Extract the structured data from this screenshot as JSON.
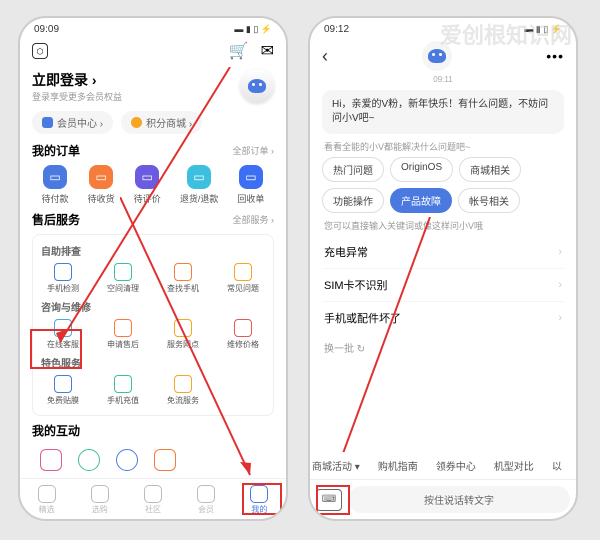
{
  "watermark": "爱创根知识网",
  "p1": {
    "time": "09:09",
    "status_icons": "◉ ⬨ ▪ ▪",
    "login_title": "立即登录 ›",
    "login_sub": "登录享受更多会员权益",
    "chip1": "会员中心 ›",
    "chip2": "积分商城 ›",
    "orders_title": "我的订单",
    "orders_more": "全部订单 ›",
    "orders": [
      {
        "label": "待付款",
        "color": "#4a7ae0"
      },
      {
        "label": "待收货",
        "color": "#f57c3a"
      },
      {
        "label": "待评价",
        "color": "#6b5be0"
      },
      {
        "label": "退货/退款",
        "color": "#3dc0e0"
      },
      {
        "label": "回收单",
        "color": "#3d6ff5"
      }
    ],
    "after_title": "售后服务",
    "after_more": "全部服务 ›",
    "g1_label": "自助排查",
    "g1": [
      {
        "label": "手机检测",
        "color": "#4a7ae0"
      },
      {
        "label": "空间清理",
        "color": "#3dbf9f"
      },
      {
        "label": "查找手机",
        "color": "#f57c3a"
      },
      {
        "label": "常见问题",
        "color": "#f5a623"
      }
    ],
    "g2_label": "咨询与维修",
    "g2": [
      {
        "label": "在线客服",
        "color": "#4aa7e0"
      },
      {
        "label": "申请售后",
        "color": "#f57c3a"
      },
      {
        "label": "服务网点",
        "color": "#f5a623"
      },
      {
        "label": "维修价格",
        "color": "#e05a5a"
      }
    ],
    "g3_label": "特色服务",
    "g3": [
      {
        "label": "免费贴膜",
        "color": "#4a7ae0"
      },
      {
        "label": "手机充值",
        "color": "#3dbf9f"
      },
      {
        "label": "免流服务",
        "color": "#f5a623"
      }
    ],
    "interact_title": "我的互动",
    "tabs": [
      {
        "label": "精选"
      },
      {
        "label": "选购"
      },
      {
        "label": "社区"
      },
      {
        "label": "会员"
      },
      {
        "label": "我的"
      }
    ]
  },
  "p2": {
    "time": "09:12",
    "status_icons": "◉ ▪ ▪ ▪",
    "msg_time": "09:11",
    "greeting": "Hi，亲爱的V粉，新年快乐！有什么问题，不妨问问小V吧~",
    "tags_label": "看看全能的小V都能解决什么问题吧~",
    "tags": [
      "热门问题",
      "OriginOS",
      "商城相关",
      "功能操作",
      "产品故障",
      "帐号相关"
    ],
    "active_tag_index": 4,
    "list_label": "您可以直接输入关键词或像这样问小V哦",
    "list": [
      "充电异常",
      "SIM卡不识别",
      "手机或配件坏了"
    ],
    "refresh": "换一批 ↻",
    "quick": [
      "商城活动 ▾",
      "购机指南",
      "领券中心",
      "机型对比",
      "以"
    ],
    "voice": "按住说话转文字"
  }
}
